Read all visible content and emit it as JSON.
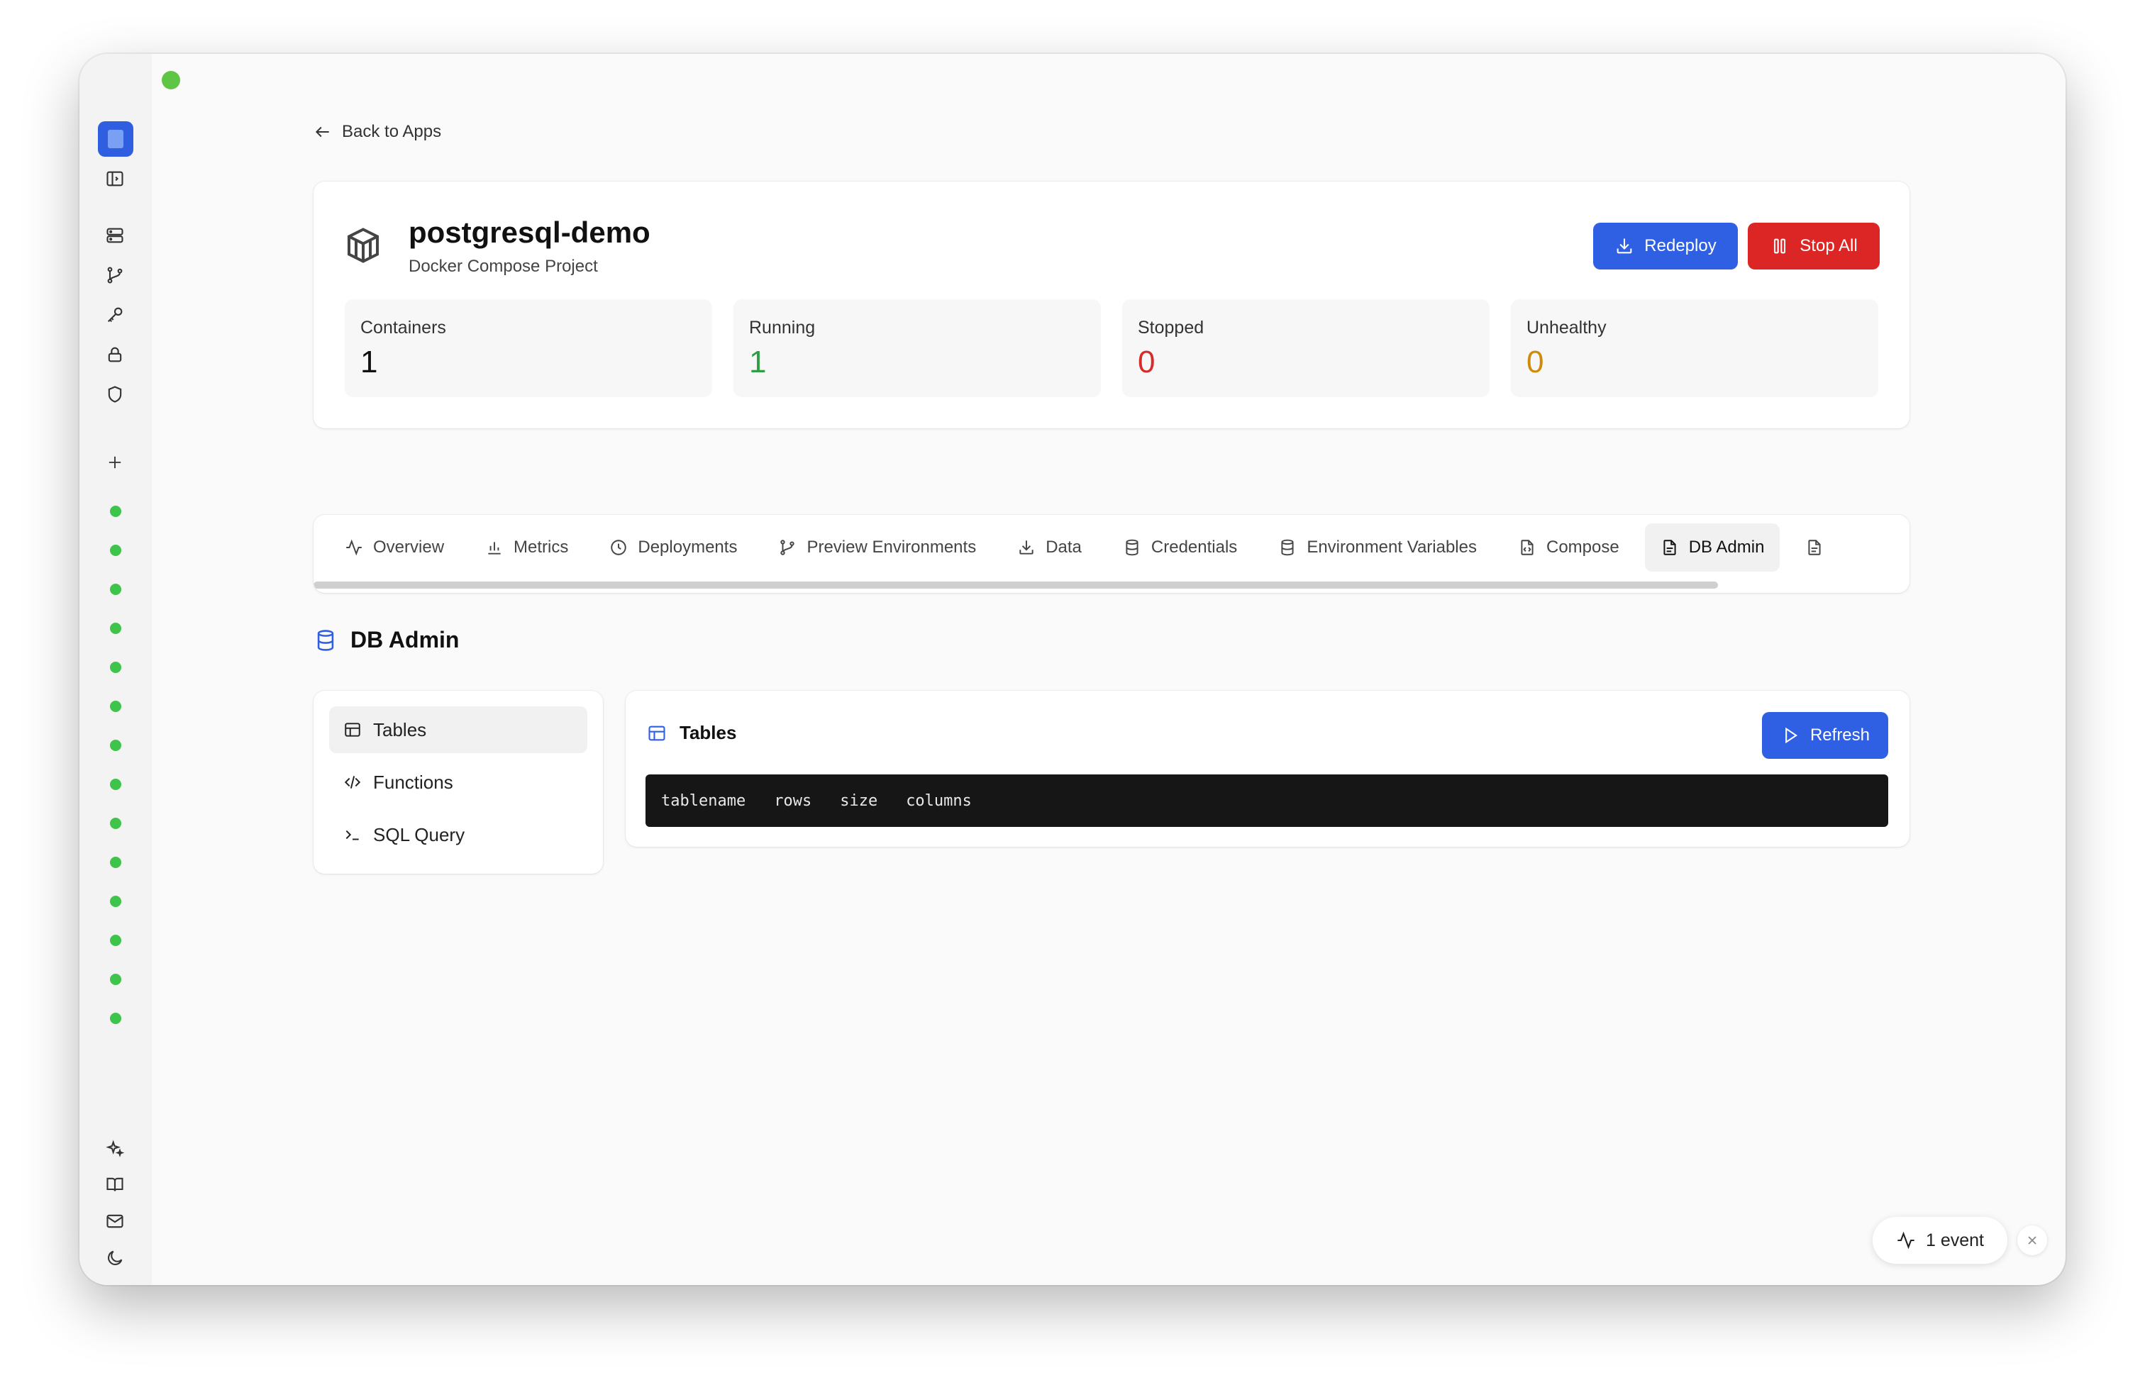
{
  "nav": {
    "back_label": "Back to Apps"
  },
  "project": {
    "title": "postgresql-demo",
    "subtitle": "Docker Compose Project",
    "redeploy_label": "Redeploy",
    "stop_all_label": "Stop All"
  },
  "stats": [
    {
      "label": "Containers",
      "value": "1",
      "color": "#111111"
    },
    {
      "label": "Running",
      "value": "1",
      "color": "#2f9e44"
    },
    {
      "label": "Stopped",
      "value": "0",
      "color": "#d62b2b"
    },
    {
      "label": "Unhealthy",
      "value": "0",
      "color": "#d08a09"
    }
  ],
  "tabs": [
    {
      "label": "Overview",
      "icon": "activity-icon"
    },
    {
      "label": "Metrics",
      "icon": "bar-chart-icon"
    },
    {
      "label": "Deployments",
      "icon": "clock-icon"
    },
    {
      "label": "Preview Environments",
      "icon": "git-branch-icon"
    },
    {
      "label": "Data",
      "icon": "download-icon"
    },
    {
      "label": "Credentials",
      "icon": "database-icon"
    },
    {
      "label": "Environment Variables",
      "icon": "database-icon"
    },
    {
      "label": "Compose",
      "icon": "file-code-icon"
    },
    {
      "label": "DB Admin",
      "icon": "file-text-icon",
      "active": true
    },
    {
      "label": "",
      "icon": "file-text-icon"
    }
  ],
  "section": {
    "title": "DB Admin"
  },
  "db_menu": [
    {
      "label": "Tables",
      "icon": "table-icon",
      "active": true
    },
    {
      "label": "Functions",
      "icon": "code-icon"
    },
    {
      "label": "SQL Query",
      "icon": "terminal-icon"
    }
  ],
  "tables_panel": {
    "title": "Tables",
    "refresh_label": "Refresh",
    "columns": [
      "tablename",
      "rows",
      "size",
      "columns"
    ]
  },
  "events": {
    "label": "1 event"
  },
  "colors": {
    "accent": "#2f5fe3",
    "danger": "#dc2626",
    "status_dot": "#3ec44a"
  }
}
